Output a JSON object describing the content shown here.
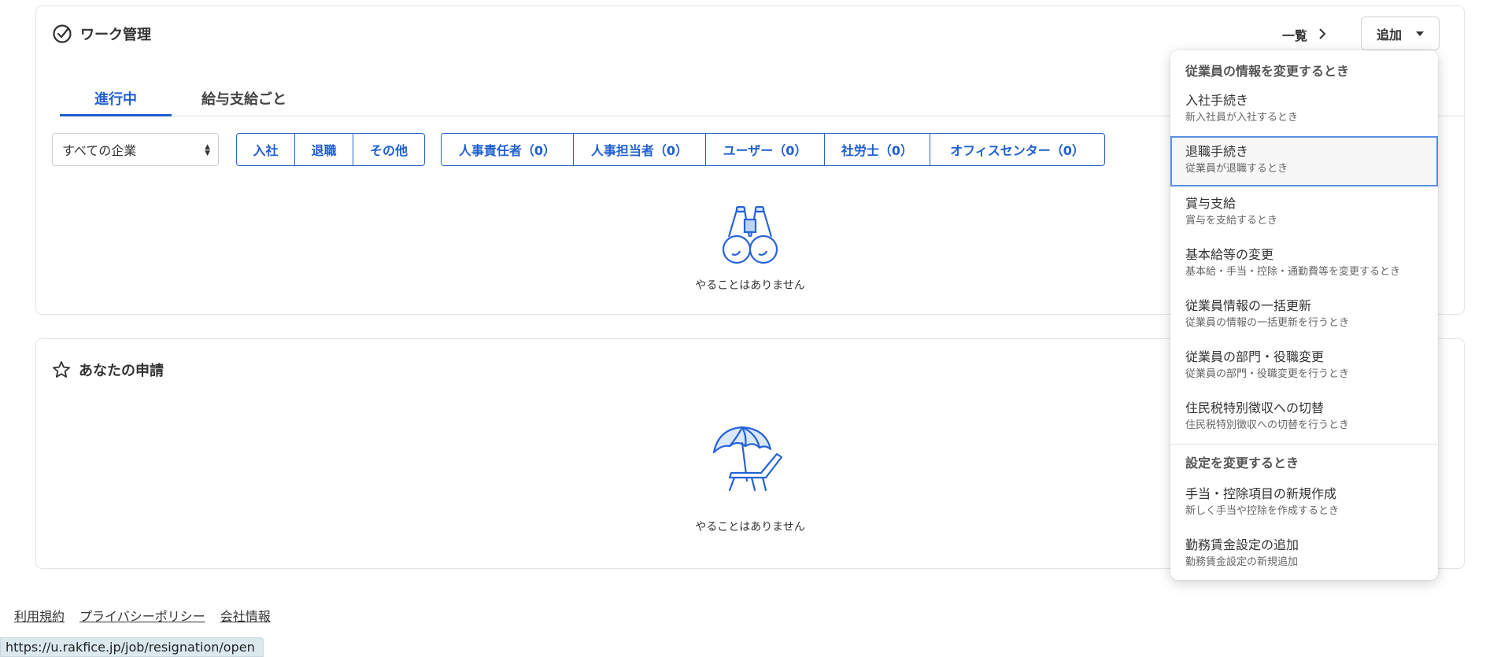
{
  "work_card": {
    "title": "ワーク管理",
    "list_link": "一覧",
    "add_button": "追加",
    "tabs": [
      {
        "label": "進行中",
        "active": true
      },
      {
        "label": "給与支給ごと",
        "active": false
      }
    ],
    "checkbox_checked": true,
    "company_select": "すべての企業",
    "type_filters": [
      "入社",
      "退職",
      "その他"
    ],
    "role_filters": [
      "人事責任者（0）",
      "人事担当者（0）",
      "ユーザー（0）",
      "社労士（0）",
      "オフィスセンター（0）"
    ],
    "empty_text": "やることはありません"
  },
  "application_card": {
    "title": "あなたの申請",
    "empty_text": "やることはありません"
  },
  "dropdown": {
    "sections": [
      {
        "heading": "従業員の情報を変更するとき",
        "items": [
          {
            "title": "入社手続き",
            "subtitle": "新入社員が入社するとき"
          },
          {
            "title": "退職手続き",
            "subtitle": "従業員が退職するとき",
            "focused": true
          },
          {
            "title": "賞与支給",
            "subtitle": "賞与を支給するとき"
          },
          {
            "title": "基本給等の変更",
            "subtitle": "基本給・手当・控除・通勤費等を変更するとき"
          },
          {
            "title": "従業員情報の一括更新",
            "subtitle": "従業員の情報の一括更新を行うとき"
          },
          {
            "title": "従業員の部門・役職変更",
            "subtitle": "従業員の部門・役職変更を行うとき"
          },
          {
            "title": "住民税特別徴収への切替",
            "subtitle": "住民税特別徴収への切替を行うとき"
          }
        ]
      },
      {
        "heading": "設定を変更するとき",
        "items": [
          {
            "title": "手当・控除項目の新規作成",
            "subtitle": "新しく手当や控除を作成するとき"
          },
          {
            "title": "勤務賃金設定の追加",
            "subtitle": "勤務賃金設定の新規追加"
          }
        ]
      }
    ]
  },
  "footer": {
    "links": [
      "利用規約",
      "プライバシーポリシー",
      "会社情報"
    ]
  },
  "status_bar": {
    "url": "https://u.rakfice.jp/job/resignation/open"
  },
  "colors": {
    "accent": "#1f5fd1",
    "icon_blue": "#2563d9"
  },
  "icons": [
    "check-circle-icon",
    "chevron-right-icon",
    "caret-down-icon",
    "binoculars-icon",
    "star-icon",
    "beach-chair-icon"
  ]
}
